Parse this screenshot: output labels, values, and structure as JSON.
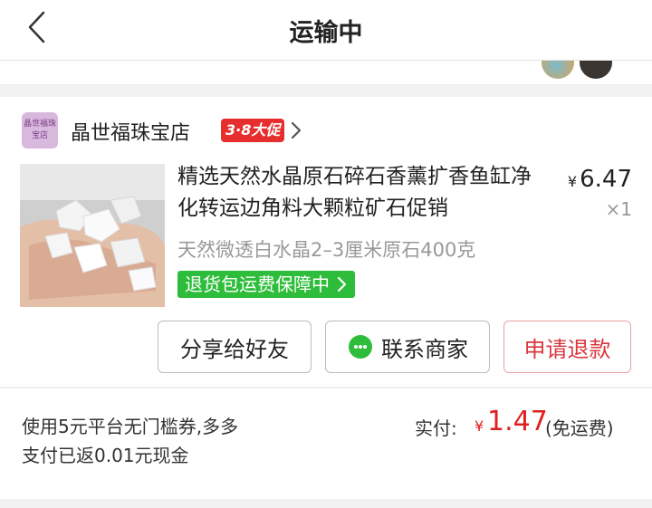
{
  "nav": {
    "title": "运输中"
  },
  "shop": {
    "logo_text": "晶世福珠宝店",
    "name": "晶世福珠宝店",
    "promo_badge": "3·8大促"
  },
  "product": {
    "title": "精选天然水晶原石碎石香薰扩香鱼缸净化转运边角料大颗粒矿石促销",
    "price_symbol": "¥",
    "price": "6.47",
    "quantity": "×1",
    "spec": "天然微透白水晶2–3厘米原石400克",
    "guarantee": "退货包运费保障中"
  },
  "actions": {
    "share": "分享给好友",
    "contact": "联系商家",
    "refund": "申请退款"
  },
  "footer": {
    "coupon_line1": "使用5元平台无门槛券,多多",
    "coupon_line2": "支付已返0.01元现金",
    "pay_label": "实付:",
    "pay_symbol": "¥",
    "pay_amount": "1.47",
    "pay_note": "(免运费)"
  },
  "colors": {
    "accent_red": "#e02020",
    "guarantee_green": "#2dbd3a",
    "badge_red": "#e62e2e"
  }
}
